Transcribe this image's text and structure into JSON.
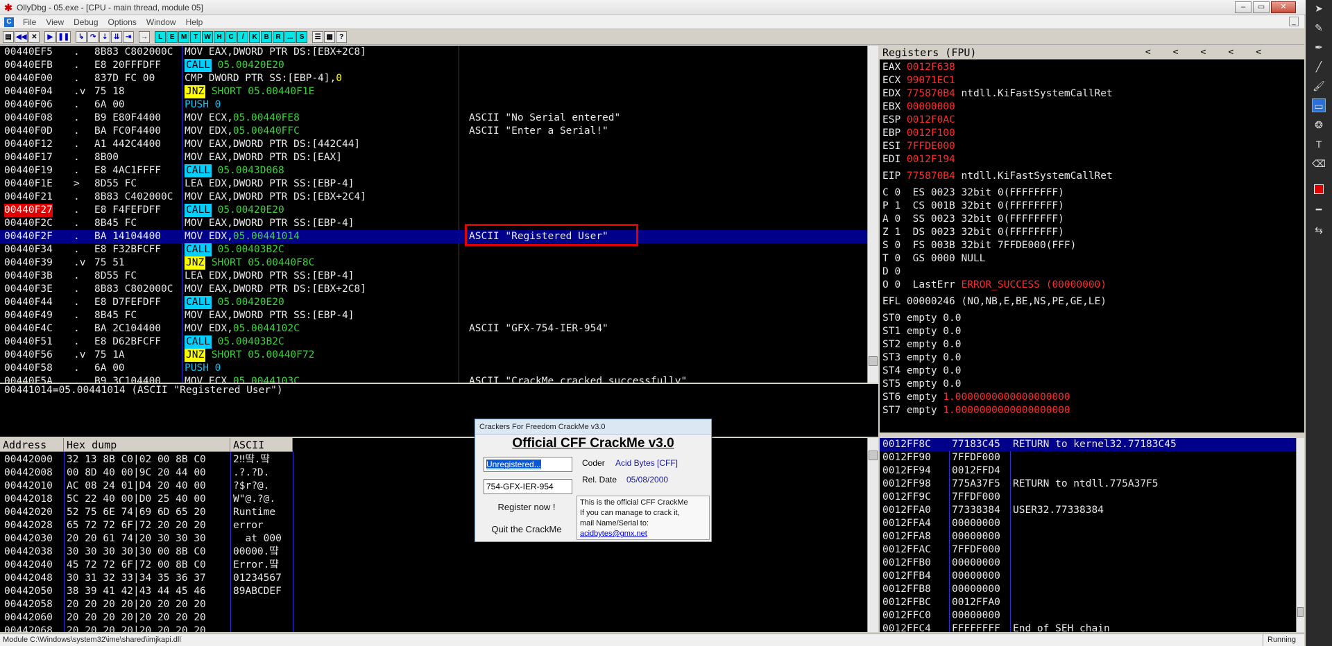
{
  "window": {
    "title": "OllyDbg - 05.exe - [CPU - main thread, module 05]",
    "app_icon": "bug-icon"
  },
  "menu": [
    "File",
    "View",
    "Debug",
    "Options",
    "Window",
    "Help"
  ],
  "menu_icon_label": "C",
  "toolbar": {
    "left_buttons": [
      "open-icon",
      "rewind-icon",
      "close-icon",
      "run-icon",
      "pause-icon",
      "step-into-icon",
      "step-over-icon",
      "trace-into-icon",
      "trace-over-icon",
      "execute-till-return-icon",
      "go-to-icon"
    ],
    "window_buttons": [
      "L",
      "E",
      "M",
      "T",
      "W",
      "H",
      "C",
      "/",
      "K",
      "B",
      "R",
      "...",
      "S"
    ],
    "right_buttons": [
      "list-icon",
      "grid-icon",
      "help-icon"
    ]
  },
  "disasm": {
    "rows": [
      {
        "addr": "00440EF5",
        "mark": ".",
        "hex": "8B83 C802000C",
        "asm": [
          {
            "t": "MOV EAX,DWORD PTR DS:[EBX+2C8]",
            "s": "plain"
          }
        ],
        "comment": ""
      },
      {
        "addr": "00440EFB",
        "mark": ".",
        "hex": "E8 20FFFDFF",
        "asm": [
          {
            "t": "CALL",
            "s": "call"
          },
          {
            "t": " 05.00420E20",
            "s": "green"
          }
        ],
        "comment": ""
      },
      {
        "addr": "00440F00",
        "mark": ".",
        "hex": "837D FC 00",
        "asm": [
          {
            "t": "CMP DWORD PTR SS:[EBP-4],",
            "s": "plain"
          },
          {
            "t": "0",
            "s": "yellow"
          }
        ],
        "comment": ""
      },
      {
        "addr": "00440F04",
        "mark": ".v",
        "hex": "75 18",
        "asm": [
          {
            "t": "JNZ",
            "s": "jnz"
          },
          {
            "t": " SHORT 05.00440F1E",
            "s": "green"
          }
        ],
        "comment": ""
      },
      {
        "addr": "00440F06",
        "mark": ".",
        "hex": "6A 00",
        "asm": [
          {
            "t": "PUSH 0",
            "s": "push"
          }
        ],
        "comment": ""
      },
      {
        "addr": "00440F08",
        "mark": ".",
        "hex": "B9 E80F4400",
        "asm": [
          {
            "t": "MOV ECX,",
            "s": "plain"
          },
          {
            "t": "05.00440FE8",
            "s": "green"
          }
        ],
        "comment": "ASCII \"No Serial entered\""
      },
      {
        "addr": "00440F0D",
        "mark": ".",
        "hex": "BA FC0F4400",
        "asm": [
          {
            "t": "MOV EDX,",
            "s": "plain"
          },
          {
            "t": "05.00440FFC",
            "s": "green"
          }
        ],
        "comment": "ASCII \"Enter a Serial!\""
      },
      {
        "addr": "00440F12",
        "mark": ".",
        "hex": "A1 442C4400",
        "asm": [
          {
            "t": "MOV EAX,DWORD PTR DS:[442C44]",
            "s": "plain"
          }
        ],
        "comment": ""
      },
      {
        "addr": "00440F17",
        "mark": ".",
        "hex": "8B00",
        "asm": [
          {
            "t": "MOV EAX,DWORD PTR DS:[EAX]",
            "s": "plain"
          }
        ],
        "comment": ""
      },
      {
        "addr": "00440F19",
        "mark": ".",
        "hex": "E8 4AC1FFFF",
        "asm": [
          {
            "t": "CALL",
            "s": "call"
          },
          {
            "t": " 05.0043D068",
            "s": "green"
          }
        ],
        "comment": ""
      },
      {
        "addr": "00440F1E",
        "mark": ">",
        "hex": "8D55 FC",
        "asm": [
          {
            "t": "LEA EDX,DWORD PTR SS:[EBP-4]",
            "s": "plain"
          }
        ],
        "comment": ""
      },
      {
        "addr": "00440F21",
        "mark": ".",
        "hex": "8B83 C402000C",
        "asm": [
          {
            "t": "MOV EAX,DWORD PTR DS:[EBX+2C4]",
            "s": "plain"
          }
        ],
        "comment": ""
      },
      {
        "addr": "00440F27",
        "mark": ".",
        "hex": "E8 F4FEFDFF",
        "asm": [
          {
            "t": "CALL",
            "s": "call"
          },
          {
            "t": " 05.00420E20",
            "s": "green"
          }
        ],
        "comment": "",
        "breakpoint": true
      },
      {
        "addr": "00440F2C",
        "mark": ".",
        "hex": "8B45 FC",
        "asm": [
          {
            "t": "MOV EAX,DWORD PTR SS:[EBP-4]",
            "s": "plain"
          }
        ],
        "comment": ""
      },
      {
        "addr": "00440F2F",
        "mark": ".",
        "hex": "BA 14104400",
        "asm": [
          {
            "t": "MOV EDX,",
            "s": "plain"
          },
          {
            "t": "05.00441014",
            "s": "green"
          }
        ],
        "comment": "ASCII \"Registered User\"",
        "selected": true
      },
      {
        "addr": "00440F34",
        "mark": ".",
        "hex": "E8 F32BFCFF",
        "asm": [
          {
            "t": "CALL",
            "s": "call"
          },
          {
            "t": " 05.00403B2C",
            "s": "green"
          }
        ],
        "comment": ""
      },
      {
        "addr": "00440F39",
        "mark": ".v",
        "hex": "75 51",
        "asm": [
          {
            "t": "JNZ",
            "s": "jnz"
          },
          {
            "t": " SHORT 05.00440F8C",
            "s": "green"
          }
        ],
        "comment": ""
      },
      {
        "addr": "00440F3B",
        "mark": ".",
        "hex": "8D55 FC",
        "asm": [
          {
            "t": "LEA EDX,DWORD PTR SS:[EBP-4]",
            "s": "plain"
          }
        ],
        "comment": ""
      },
      {
        "addr": "00440F3E",
        "mark": ".",
        "hex": "8B83 C802000C",
        "asm": [
          {
            "t": "MOV EAX,DWORD PTR DS:[EBX+2C8]",
            "s": "plain"
          }
        ],
        "comment": ""
      },
      {
        "addr": "00440F44",
        "mark": ".",
        "hex": "E8 D7FEFDFF",
        "asm": [
          {
            "t": "CALL",
            "s": "call"
          },
          {
            "t": " 05.00420E20",
            "s": "green"
          }
        ],
        "comment": ""
      },
      {
        "addr": "00440F49",
        "mark": ".",
        "hex": "8B45 FC",
        "asm": [
          {
            "t": "MOV EAX,DWORD PTR SS:[EBP-4]",
            "s": "plain"
          }
        ],
        "comment": ""
      },
      {
        "addr": "00440F4C",
        "mark": ".",
        "hex": "BA 2C104400",
        "asm": [
          {
            "t": "MOV EDX,",
            "s": "plain"
          },
          {
            "t": "05.0044102C",
            "s": "green"
          }
        ],
        "comment": "ASCII \"GFX-754-IER-954\""
      },
      {
        "addr": "00440F51",
        "mark": ".",
        "hex": "E8 D62BFCFF",
        "asm": [
          {
            "t": "CALL",
            "s": "call"
          },
          {
            "t": " 05.00403B2C",
            "s": "green"
          }
        ],
        "comment": ""
      },
      {
        "addr": "00440F56",
        "mark": ".v",
        "hex": "75 1A",
        "asm": [
          {
            "t": "JNZ",
            "s": "jnz"
          },
          {
            "t": " SHORT 05.00440F72",
            "s": "green"
          }
        ],
        "comment": ""
      },
      {
        "addr": "00440F58",
        "mark": ".",
        "hex": "6A 00",
        "asm": [
          {
            "t": "PUSH 0",
            "s": "push"
          }
        ],
        "comment": ""
      },
      {
        "addr": "00440F5A",
        "mark": ".",
        "hex": "B9 3C104400",
        "asm": [
          {
            "t": "MOV ECX,",
            "s": "plain"
          },
          {
            "t": "05.0044103C",
            "s": "green"
          }
        ],
        "comment": "ASCII \"CrackMe cracked successfully\""
      }
    ]
  },
  "info_line": "00441014=05.00441014 (ASCII \"Registered User\")",
  "registers": {
    "header": "Registers (FPU)",
    "header_arrows": "<<<<<",
    "gprs": [
      {
        "name": "EAX",
        "value": "0012F638",
        "note": ""
      },
      {
        "name": "ECX",
        "value": "99071EC1",
        "note": ""
      },
      {
        "name": "EDX",
        "value": "775870B4",
        "note": "ntdll.KiFastSystemCallRet"
      },
      {
        "name": "EBX",
        "value": "00000000",
        "note": ""
      },
      {
        "name": "ESP",
        "value": "0012F0AC",
        "note": ""
      },
      {
        "name": "EBP",
        "value": "0012F100",
        "note": ""
      },
      {
        "name": "ESI",
        "value": "7FFDE000",
        "note": ""
      },
      {
        "name": "EDI",
        "value": "0012F194",
        "note": ""
      }
    ],
    "eip": {
      "name": "EIP",
      "value": "775870B4",
      "note": "ntdll.KiFastSystemCallRet"
    },
    "flags": [
      "C 0  ES 0023 32bit 0(FFFFFFFF)",
      "P 1  CS 001B 32bit 0(FFFFFFFF)",
      "A 0  SS 0023 32bit 0(FFFFFFFF)",
      "Z 1  DS 0023 32bit 0(FFFFFFFF)",
      "S 0  FS 003B 32bit 7FFDE000(FFF)",
      "T 0  GS 0000 NULL",
      "D 0"
    ],
    "lasterr": {
      "prefix": "O 0  LastErr ",
      "value": "ERROR_SUCCESS (00000000)"
    },
    "efl": "EFL 00000246 (NO,NB,E,BE,NS,PE,GE,LE)",
    "fpu": [
      {
        "name": "ST0",
        "text": "empty 0.0",
        "red": ""
      },
      {
        "name": "ST1",
        "text": "empty 0.0",
        "red": ""
      },
      {
        "name": "ST2",
        "text": "empty 0.0",
        "red": ""
      },
      {
        "name": "ST3",
        "text": "empty 0.0",
        "red": ""
      },
      {
        "name": "ST4",
        "text": "empty 0.0",
        "red": ""
      },
      {
        "name": "ST5",
        "text": "empty 0.0",
        "red": ""
      },
      {
        "name": "ST6",
        "text": "empty ",
        "red": "1.0000000000000000000"
      },
      {
        "name": "ST7",
        "text": "empty ",
        "red": "1.0000000000000000000"
      }
    ]
  },
  "dump": {
    "headers": [
      "Address",
      "Hex dump",
      "ASCII"
    ],
    "rows": [
      {
        "addr": "00442000",
        "hex": "32 13 8B C0|02 00 8B C0",
        "ascii": "2‼떀.떀"
      },
      {
        "addr": "00442008",
        "hex": "00 8D 40 00|9C 20 44 00",
        "ascii": ".?.?D."
      },
      {
        "addr": "00442010",
        "hex": "AC 08 24 01|D4 20 40 00",
        "ascii": "?$r?@."
      },
      {
        "addr": "00442018",
        "hex": "5C 22 40 00|D0 25 40 00",
        "ascii": "W\"@.?@."
      },
      {
        "addr": "00442020",
        "hex": "52 75 6E 74|69 6D 65 20",
        "ascii": "Runtime "
      },
      {
        "addr": "00442028",
        "hex": "65 72 72 6F|72 20 20 20",
        "ascii": "error   "
      },
      {
        "addr": "00442030",
        "hex": "20 20 61 74|20 30 30 30",
        "ascii": "  at 000"
      },
      {
        "addr": "00442038",
        "hex": "30 30 30 30|30 00 8B C0",
        "ascii": "00000.떀"
      },
      {
        "addr": "00442040",
        "hex": "45 72 72 6F|72 00 8B C0",
        "ascii": "Error.떀"
      },
      {
        "addr": "00442048",
        "hex": "30 31 32 33|34 35 36 37",
        "ascii": "01234567"
      },
      {
        "addr": "00442050",
        "hex": "38 39 41 42|43 44 45 46",
        "ascii": "89ABCDEF"
      },
      {
        "addr": "00442058",
        "hex": "20 20 20 20|20 20 20 20",
        "ascii": ""
      },
      {
        "addr": "00442060",
        "hex": "20 20 20 20|20 20 20 20",
        "ascii": ""
      },
      {
        "addr": "00442068",
        "hex": "20 20 20 20|20 20 20 20",
        "ascii": ""
      }
    ]
  },
  "stack": {
    "rows": [
      {
        "addr": "0012FF8C",
        "value": "77183C45",
        "comment": "RETURN to kernel32.77183C45",
        "selected": true
      },
      {
        "addr": "0012FF90",
        "value": "7FFDF000",
        "comment": ""
      },
      {
        "addr": "0012FF94",
        "value": "0012FFD4",
        "comment": ""
      },
      {
        "addr": "0012FF98",
        "value": "775A37F5",
        "comment": "RETURN to ntdll.775A37F5"
      },
      {
        "addr": "0012FF9C",
        "value": "7FFDF000",
        "comment": ""
      },
      {
        "addr": "0012FFA0",
        "value": "77338384",
        "comment": "USER32.77338384"
      },
      {
        "addr": "0012FFA4",
        "value": "00000000",
        "comment": ""
      },
      {
        "addr": "0012FFA8",
        "value": "00000000",
        "comment": ""
      },
      {
        "addr": "0012FFAC",
        "value": "7FFDF000",
        "comment": ""
      },
      {
        "addr": "0012FFB0",
        "value": "00000000",
        "comment": ""
      },
      {
        "addr": "0012FFB4",
        "value": "00000000",
        "comment": ""
      },
      {
        "addr": "0012FFB8",
        "value": "00000000",
        "comment": ""
      },
      {
        "addr": "0012FFBC",
        "value": "0012FFA0",
        "comment": ""
      },
      {
        "addr": "0012FFC0",
        "value": "00000000",
        "comment": ""
      },
      {
        "addr": "0012FFC4",
        "value": "FFFFFFFF",
        "comment": "End of SEH chain"
      }
    ]
  },
  "crackme": {
    "title": "Crackers For Freedom CrackMe v3.0",
    "heading": "Official CFF CrackMe v3.0",
    "name_value": "Unregistered...",
    "serial_value": "754-GFX-IER-954",
    "coder_label": "Coder",
    "coder_value": "Acid Bytes [CFF]",
    "date_label": "Rel. Date",
    "date_value": "05/08/2000",
    "register_btn": "Register now !",
    "quit_btn": "Quit the CrackMe",
    "info_lines": [
      "This is the official CFF CrackMe",
      "If you can manage to crack it,",
      "mail Name/Serial to:"
    ],
    "info_email": "acidbytes@gmx.net"
  },
  "status": {
    "left": "Module C:\\Windows\\system32\\ime\\shared\\imjkapi.dll",
    "right": "Running"
  },
  "right_toolbar": [
    "pointer-icon",
    "pencil-icon",
    "pen-icon",
    "line-icon",
    "brush-icon",
    "rectangle-icon",
    "paint-icon",
    "text-icon",
    "eraser-icon",
    "color-swatch-icon",
    "line-weight-icon",
    "swap-icon"
  ],
  "colors": {
    "selection": "#00008b",
    "breakpoint": "#e00000",
    "call_bg": "#00d0ff",
    "jnz_bg": "#ffff00",
    "address_text": "#3cd23c",
    "register_changed": "#ff2a2a"
  }
}
